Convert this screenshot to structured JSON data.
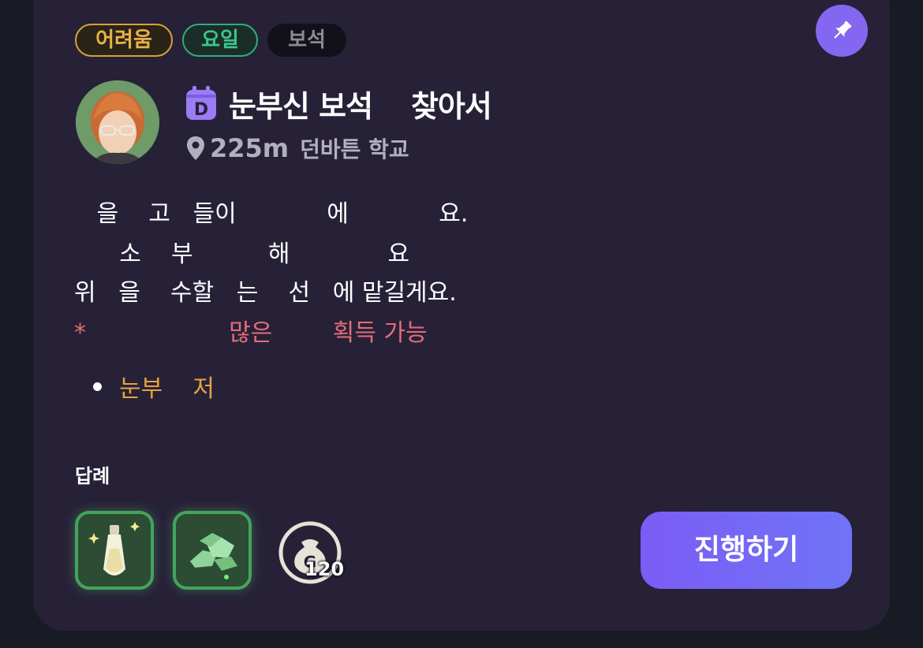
{
  "tags": {
    "difficulty": "어려움",
    "day": "요일",
    "category": "보석"
  },
  "quest": {
    "title": "눈부신 보석    찾아서",
    "distance": "225m",
    "location": "던바튼 학교"
  },
  "description": {
    "line1": "   을    고   들이            에            요.",
    "line2": "      소    부          해             요",
    "line3": "위   을    수할   는    선   에 맡길게요.",
    "note": "*                   많은        획득 가능",
    "bullet": "눈부    저"
  },
  "rewards": {
    "label": "답례",
    "coin_count": "120"
  },
  "actions": {
    "proceed": "진행하기"
  },
  "icons": {
    "pin": "pin-icon",
    "calendar": "calendar-d-icon",
    "location": "location-pin-icon",
    "reward1": "potion-icon",
    "reward2": "gem-pile-icon",
    "coin": "coin-bag-icon"
  },
  "colors": {
    "card_bg": "#272138",
    "accent": "#8467f1",
    "difficulty": "#e8b24a",
    "day": "#3ac58b",
    "note": "#e36d77",
    "bullet": "#e8a23f"
  }
}
